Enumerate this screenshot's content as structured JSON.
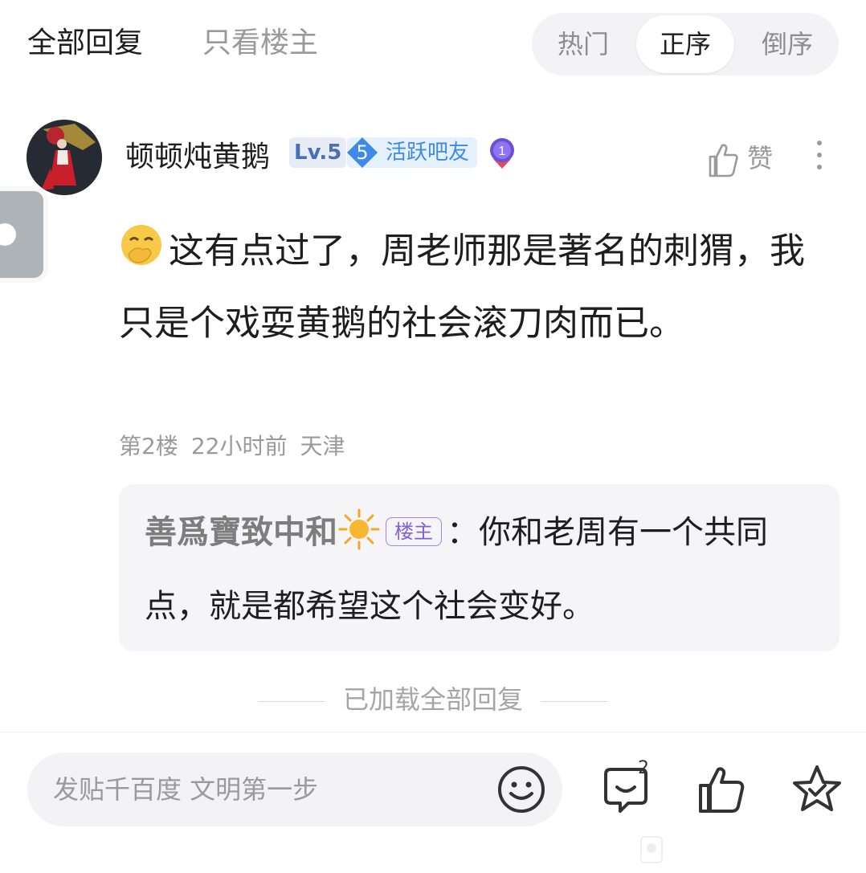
{
  "tabs": {
    "all": "全部回复",
    "op_only": "只看楼主",
    "sort": [
      "热门",
      "正序",
      "倒序"
    ],
    "sort_selected": "正序"
  },
  "comment": {
    "username": "顿顿炖黄鹅",
    "level": "Lv.5",
    "active_badge_num": "5",
    "active_badge_text": "活跃吧友",
    "medal_num": "1",
    "like_label": "赞",
    "text": "这有点过了，周老师那是著名的刺猬，我只是个戏耍黄鹅的社会滚刀肉而已。",
    "meta": {
      "floor": "第2楼",
      "time": "22小时前",
      "location": "天津"
    }
  },
  "reply": {
    "author": "善爲寶致中和",
    "op_tag": "楼主",
    "colon": "：",
    "text": "你和老周有一个共同点，就是都希望这个社会变好。"
  },
  "loaded_all": "已加载全部回复",
  "bottom_bar": {
    "placeholder": "发贴千百度 文明第一步",
    "reply_count": "2"
  },
  "colors": {
    "accent_blue": "#3f8ae8",
    "op_tag_purple": "#7e62d6",
    "gray_text": "#9a9a9a"
  }
}
